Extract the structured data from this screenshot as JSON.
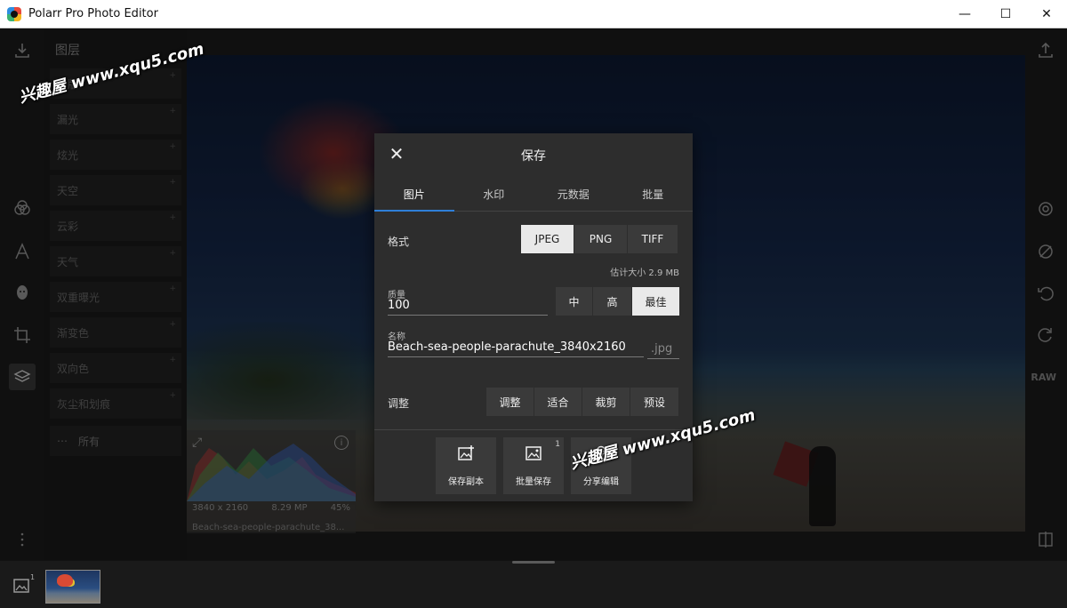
{
  "window": {
    "title": "Polarr Pro Photo Editor",
    "controls": [
      "—",
      "☐",
      "✕"
    ]
  },
  "layers": {
    "title": "图层",
    "items": [
      {
        "label": "蒙版"
      },
      {
        "label": "漏光"
      },
      {
        "label": "炫光"
      },
      {
        "label": "天空"
      },
      {
        "label": "云彩"
      },
      {
        "label": "天气"
      },
      {
        "label": "双重曝光"
      },
      {
        "label": "渐变色"
      },
      {
        "label": "双向色"
      },
      {
        "label": "灰尘和划痕"
      }
    ],
    "all_label": "所有",
    "all_dots": "⋯"
  },
  "right_rail": {
    "raw_label": "RAW"
  },
  "histogram": {
    "resolution": "3840 x 2160",
    "megapixels": "8.29 MP",
    "zoom": "45%",
    "filename": "Beach-sea-people-parachute_38..."
  },
  "dialog": {
    "title": "保存",
    "tabs": [
      {
        "label": "图片"
      },
      {
        "label": "水印"
      },
      {
        "label": "元数据"
      },
      {
        "label": "批量"
      }
    ],
    "format": {
      "label": "格式",
      "options": [
        "JPEG",
        "PNG",
        "TIFF"
      ],
      "selected": "JPEG"
    },
    "estimated_size": "估计大小 2.9 MB",
    "quality": {
      "label": "质量",
      "value": "100",
      "options": [
        "中",
        "高",
        "最佳"
      ],
      "selected": "最佳"
    },
    "name": {
      "label": "名称",
      "value": "Beach-sea-people-parachute_3840x2160",
      "extension": ".jpg"
    },
    "adjust": {
      "label": "调整",
      "options": [
        "调整",
        "适合",
        "裁剪",
        "预设"
      ]
    },
    "actions": [
      {
        "label": "保存副本",
        "icon": "image-plus-icon"
      },
      {
        "label": "批量保存",
        "icon": "images-icon",
        "badge": "1"
      },
      {
        "label": "分享编辑",
        "icon": "share-edit-icon"
      }
    ]
  },
  "filmstrip": {
    "count_badge": "1"
  },
  "watermarks": [
    "兴趣屋 www.xqu5.com",
    "兴趣屋 www.xqu5.com"
  ]
}
